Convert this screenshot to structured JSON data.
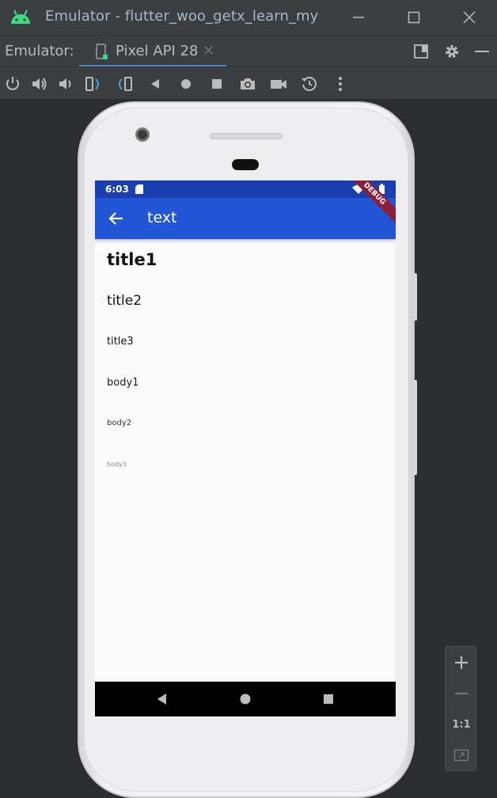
{
  "window": {
    "title": "Emulator - flutter_woo_getx_learn_my"
  },
  "tabbar": {
    "label": "Emulator:",
    "tab_label": "Pixel API 28",
    "close": "×"
  },
  "phone": {
    "status_time": "6:03",
    "appbar_title": "text",
    "debug_banner": "DEBUG",
    "texts": {
      "title1": "title1",
      "title2": "title2",
      "title3": "title3",
      "body1": "body1",
      "body2": "body2",
      "body3": "body3"
    }
  },
  "zoom": {
    "one_to_one": "1:1"
  },
  "colors": {
    "appbar": "#2356d6",
    "statusbar": "#1c3fb0",
    "accent": "#4a88c7",
    "android_green": "#3ddc84"
  }
}
